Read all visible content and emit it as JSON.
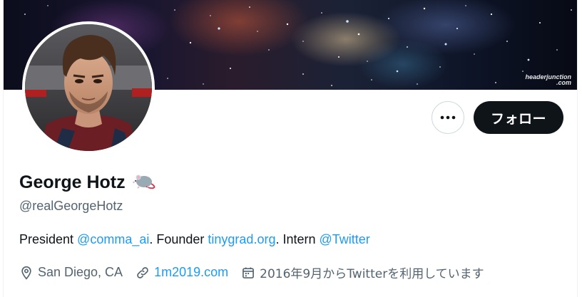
{
  "banner": {
    "watermark_line1": "headerjunction",
    "watermark_line2": ".com"
  },
  "profile": {
    "display_name": "George Hotz",
    "name_emoji_icon": "rat-icon",
    "handle": "@realGeorgeHotz",
    "bio": {
      "part1": "President ",
      "mention1": "@comma_ai",
      "part2": ". Founder ",
      "link1": "tinygrad.org",
      "part3": ". Intern ",
      "mention2": "@Twitter"
    },
    "location": "San Diego, CA",
    "website": "1m2019.com",
    "joined": "2016年9月からTwitterを利用しています"
  },
  "actions": {
    "more_icon": "more-dots-icon",
    "follow_label": "フォロー"
  },
  "colors": {
    "link": "#1d9bf0",
    "secondary_text": "#536471",
    "primary_text": "#0f1419",
    "follow_button_bg": "#0f1419"
  }
}
